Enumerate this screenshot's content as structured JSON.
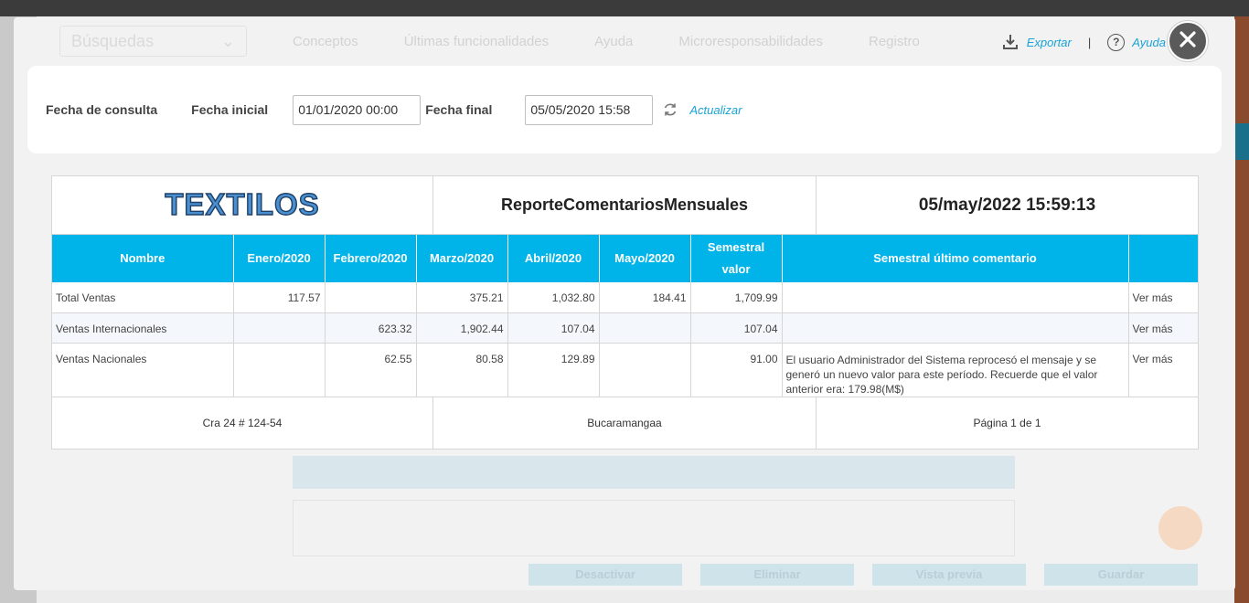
{
  "background": {
    "search_placeholder": "Búsquedas",
    "nav": [
      "Conceptos",
      "Últimas funcionalidades",
      "Ayuda",
      "Microresponsabilidades",
      "Registro"
    ],
    "buttons": [
      "Desactivar",
      "Eliminar",
      "Vista previa",
      "Guardar"
    ]
  },
  "toolbar": {
    "export_label": "Exportar",
    "separator": "|",
    "help_label": "Ayuda",
    "help_glyph": "?"
  },
  "filters": {
    "section_label": "Fecha de consulta",
    "start_label": "Fecha inicial",
    "start_value": "01/01/2020 00:00",
    "end_label": "Fecha final",
    "end_value": "05/05/2020 15:58",
    "refresh_label": "Actualizar"
  },
  "report": {
    "logo_text": "TEXTILOS",
    "title": "ReporteComentariosMensuales",
    "datetime": "05/may/2022 15:59:13",
    "columns": [
      "Nombre",
      "Enero/2020",
      "Febrero/2020",
      "Marzo/2020",
      "Abril/2020",
      "Mayo/2020",
      "Semestral valor",
      "Semestral último comentario",
      ""
    ],
    "rows": [
      {
        "name": "Total Ventas",
        "enero": "117.57",
        "febrero": "",
        "marzo": "375.21",
        "abril": "1,032.80",
        "mayo": "184.41",
        "semestral": "1,709.99",
        "comentario": "",
        "link": "Ver más"
      },
      {
        "name": "Ventas Internacionales",
        "enero": "",
        "febrero": "623.32",
        "marzo": "1,902.44",
        "abril": "107.04",
        "mayo": "",
        "semestral": "107.04",
        "comentario": "",
        "link": "Ver más"
      },
      {
        "name": "Ventas Nacionales",
        "enero": "",
        "febrero": "62.55",
        "marzo": "80.58",
        "abril": "129.89",
        "mayo": "",
        "semestral": "91.00",
        "comentario": "El usuario Administrador del Sistema reprocesó el mensaje y se generó un nuevo valor para este período. Recuerde que el valor anterior era: 179.98(M$)",
        "link": "Ver más"
      }
    ],
    "footer": {
      "address": "Cra 24 # 124-54",
      "city": "Bucaramangaa",
      "pagination": "Página 1 de  1"
    }
  },
  "colors": {
    "accent": "#00b4ea",
    "link": "#1aa3d6",
    "close_button": "#5a5a5a"
  }
}
